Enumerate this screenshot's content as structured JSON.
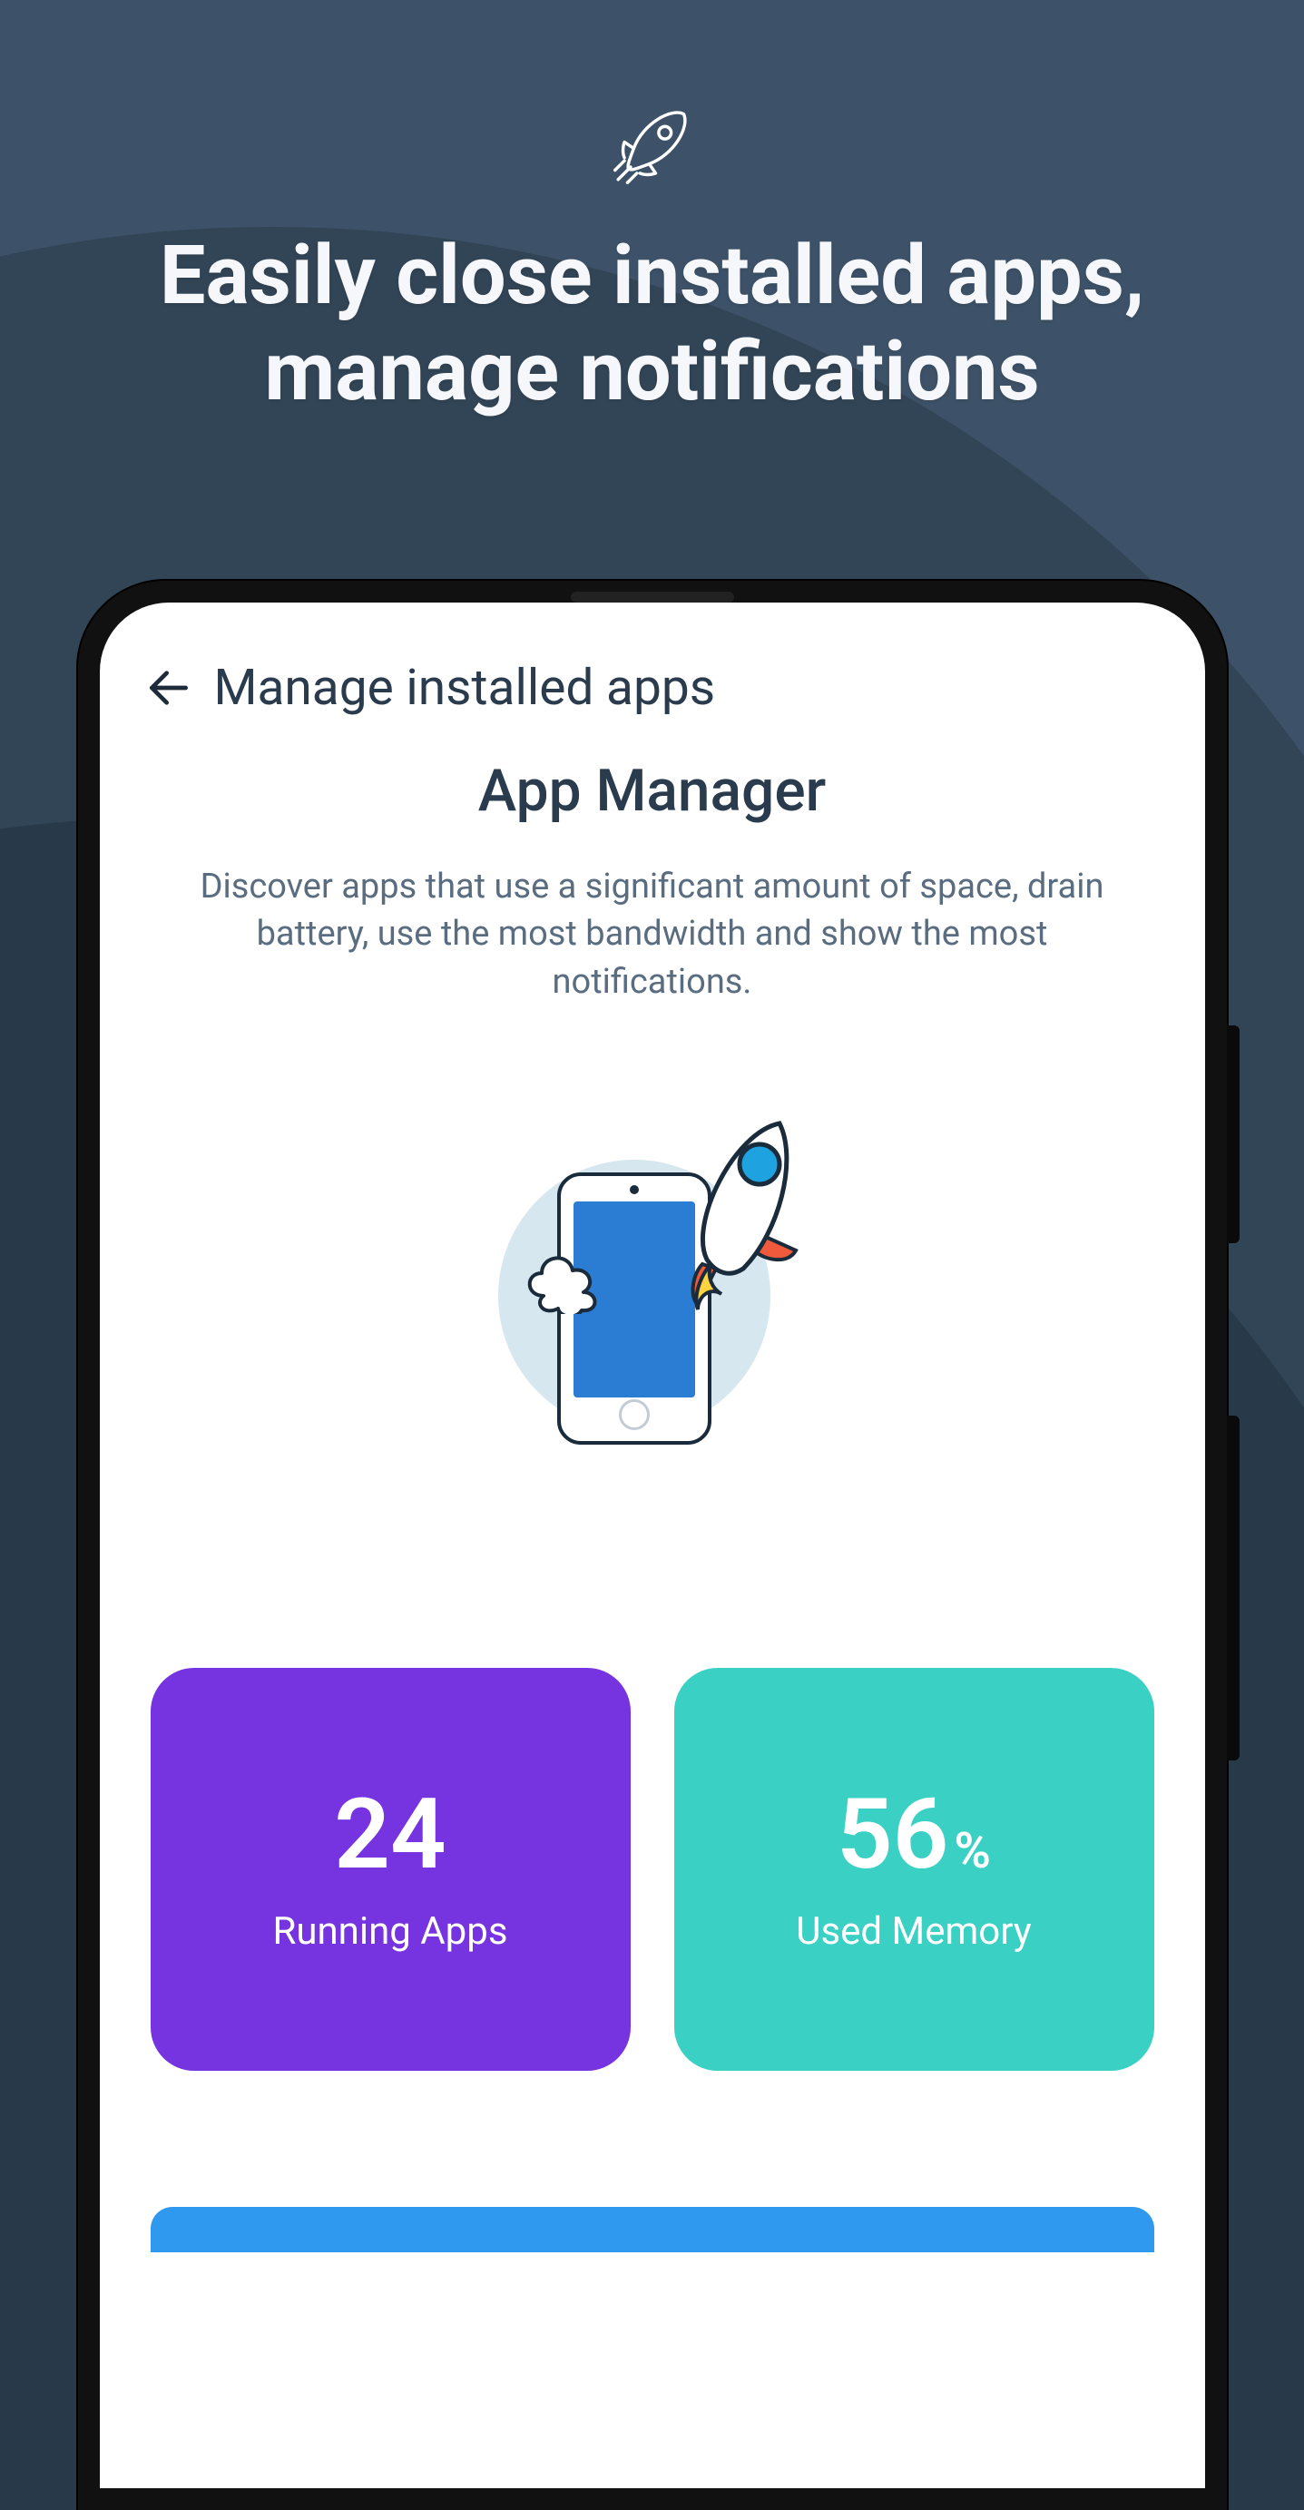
{
  "hero": {
    "title_line1": "Easily close installed apps,",
    "title_line2": "manage notifications"
  },
  "screen": {
    "topbar_title": "Manage installed apps",
    "page_title": "App Manager",
    "description": "Discover apps that use a significant amount of space, drain battery, use the most bandwidth and show the most notifications."
  },
  "cards": {
    "running_apps": {
      "value": "24",
      "label": "Running Apps"
    },
    "used_memory": {
      "value": "56",
      "unit": "%",
      "label": "Used Memory"
    }
  }
}
